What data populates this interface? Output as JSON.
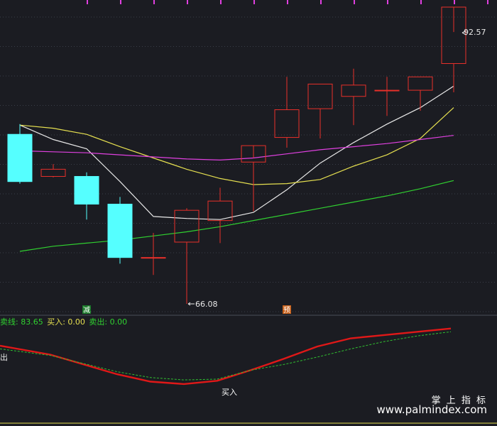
{
  "chart_data": [
    {
      "type": "candlestick",
      "title": "",
      "annotations": {
        "high_label": "92.57",
        "low_label": "66.08"
      },
      "markers": [
        {
          "candle": 2,
          "text": "减",
          "color": "#1a7a2a"
        },
        {
          "candle": 8,
          "text": "预",
          "color": "#c8601a"
        }
      ],
      "candles": [
        {
          "o": 82.6,
          "h": 83.6,
          "l": 77.8,
          "c": 78.0,
          "dir": "down"
        },
        {
          "o": 78.5,
          "h": 79.7,
          "l": 78.4,
          "c": 79.2,
          "dir": "up"
        },
        {
          "o": 78.5,
          "h": 78.9,
          "l": 74.3,
          "c": 75.8,
          "dir": "down"
        },
        {
          "o": 75.8,
          "h": 76.5,
          "l": 70.0,
          "c": 70.6,
          "dir": "down"
        },
        {
          "o": 70.6,
          "h": 73.0,
          "l": 68.9,
          "c": 70.6,
          "dir": "up"
        },
        {
          "o": 72.1,
          "h": 75.4,
          "l": 66.08,
          "c": 75.2,
          "dir": "up"
        },
        {
          "o": 74.2,
          "h": 77.4,
          "l": 72.0,
          "c": 76.1,
          "dir": "up"
        },
        {
          "o": 79.9,
          "h": 80.3,
          "l": 75.1,
          "c": 81.5,
          "dir": "up"
        },
        {
          "o": 82.3,
          "h": 88.2,
          "l": 81.3,
          "c": 85.0,
          "dir": "up"
        },
        {
          "o": 85.1,
          "h": 87.5,
          "l": 82.2,
          "c": 87.5,
          "dir": "up"
        },
        {
          "o": 86.3,
          "h": 89.0,
          "l": 83.5,
          "c": 87.4,
          "dir": "up"
        },
        {
          "o": 86.9,
          "h": 88.2,
          "l": 84.4,
          "c": 86.9,
          "dir": "up"
        },
        {
          "o": 86.9,
          "h": 88.2,
          "l": 84.9,
          "c": 88.2,
          "dir": "up"
        },
        {
          "o": 89.5,
          "h": 92.57,
          "l": 86.7,
          "c": 95.0,
          "dir": "up"
        }
      ],
      "ma_lines": [
        {
          "color": "#e8e8e8",
          "values": [
            83.5,
            82.1,
            81.2,
            78.0,
            74.6,
            74.4,
            74.3,
            75.0,
            77.2,
            79.8,
            81.8,
            83.6,
            85.2,
            87.3
          ]
        },
        {
          "color": "#e6e050",
          "values": [
            83.5,
            83.2,
            82.6,
            81.4,
            80.3,
            79.2,
            78.3,
            77.7,
            77.8,
            78.2,
            79.5,
            80.6,
            82.2,
            85.2
          ]
        },
        {
          "color": "#e040e0",
          "values": [
            81.0,
            80.9,
            80.8,
            80.6,
            80.4,
            80.2,
            80.1,
            80.3,
            80.7,
            81.1,
            81.4,
            81.7,
            82.1,
            82.5
          ]
        },
        {
          "color": "#30d030",
          "values": [
            71.2,
            71.7,
            72.0,
            72.3,
            72.7,
            73.1,
            73.6,
            74.2,
            74.8,
            75.4,
            76.0,
            76.6,
            77.3,
            78.1
          ]
        }
      ]
    },
    {
      "type": "line",
      "ylim": [
        0,
        100
      ],
      "legend_items": [
        {
          "text": "卖线: 83.65",
          "color": "#30d030"
        },
        {
          "text": "买入: 0.00",
          "color": "#e6e050"
        },
        {
          "text": "卖出: 0.00",
          "color": "#30d030"
        }
      ],
      "labels": {
        "left_edge": "出",
        "buy_marker": "买入"
      },
      "x": [
        0,
        1,
        2,
        3,
        4,
        5,
        6,
        7,
        8,
        9,
        10,
        11,
        12,
        13
      ],
      "series": [
        {
          "color": "#e01818",
          "values": [
            81.0,
            70.0,
            58.0,
            46.0,
            37.0,
            34.0,
            38.0,
            51.0,
            65.0,
            80.0,
            90.0,
            94.0,
            98.0,
            102.0
          ]
        },
        {
          "color": "#30c030",
          "values": [
            77.0,
            69.0,
            59.0,
            49.0,
            42.0,
            39.0,
            40.0,
            51.0,
            58.0,
            67.0,
            77.0,
            86.0,
            93.0,
            98.0
          ]
        }
      ]
    }
  ],
  "watermark": {
    "line1": "掌 上 指 标",
    "line2": "www.palmindex.com"
  }
}
